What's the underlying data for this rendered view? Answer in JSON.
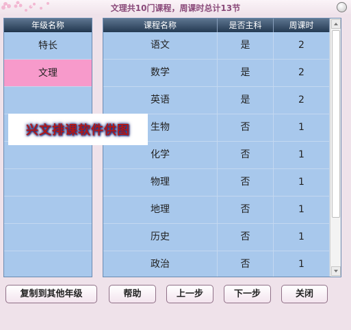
{
  "window": {
    "title": "文理共10门课程，周课时总计13节",
    "close_icon": "circle-close-icon"
  },
  "grade_panel": {
    "header": "年级名称",
    "rows": [
      "特长",
      "文理"
    ],
    "selected_index": 1
  },
  "course_table": {
    "headers": [
      "课程名称",
      "是否主科",
      "周课时"
    ],
    "rows": [
      [
        "语文",
        "是",
        "2"
      ],
      [
        "数学",
        "是",
        "2"
      ],
      [
        "英语",
        "是",
        "2"
      ],
      [
        "生物",
        "否",
        "1"
      ],
      [
        "化学",
        "否",
        "1"
      ],
      [
        "物理",
        "否",
        "1"
      ],
      [
        "地理",
        "否",
        "1"
      ],
      [
        "历史",
        "否",
        "1"
      ],
      [
        "政治",
        "否",
        "1"
      ]
    ]
  },
  "watermark": {
    "text": "兴文排课软件供图"
  },
  "buttons": {
    "copy": "复制到其他年级",
    "help": "帮助",
    "prev": "上一步",
    "next": "下一步",
    "close": "关闭"
  },
  "colors": {
    "panel_bg": "#a8c8ec",
    "header_dark": "#243a52",
    "selected_row": "#f79acb",
    "window_bg": "#efe2ea",
    "title_text": "#8a4a7a"
  }
}
